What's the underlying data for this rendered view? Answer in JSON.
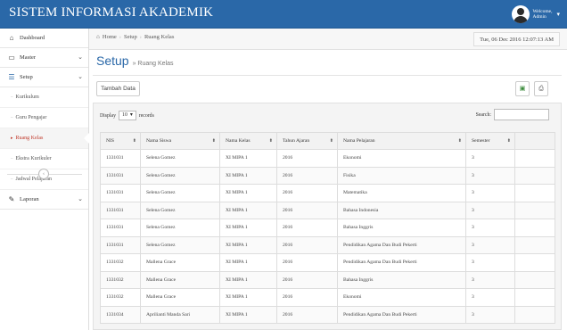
{
  "app": {
    "title": "SISTEM INFORMASI AKADEMIK"
  },
  "user": {
    "greeting": "Welcome,",
    "name": "Admin"
  },
  "sidebar": {
    "items": [
      {
        "label": "Dashboard",
        "icon": "dashboard-icon"
      },
      {
        "label": "Master",
        "icon": "monitor-icon"
      },
      {
        "label": "Setup",
        "icon": "list-icon"
      },
      {
        "label": "Laporan",
        "icon": "edit-icon"
      }
    ],
    "setup_children": [
      "Kurikulum",
      "Guru Pengajar",
      "Ruang Kelas",
      "Ekstra Kurikuler",
      "Jadwal Pelajaran"
    ],
    "active": "Ruang Kelas"
  },
  "breadcrumb": {
    "home": "Home",
    "setup": "Setup",
    "current": "Ruang Kelas"
  },
  "datetime": "Tue, 06 Dec 2016  12:07:13 AM",
  "page": {
    "title": "Setup",
    "subtitle": "» Ruang Kelas"
  },
  "toolbar": {
    "add_label": "Tambah Data"
  },
  "table_controls": {
    "display_label": "Display",
    "display_value": "10",
    "records_label": "records",
    "search_label": "Search:"
  },
  "table": {
    "headers": [
      "NIS",
      "Nama Siswa",
      "Nama Kelas",
      "Tahun Ajaran",
      "Nama Pelajaran",
      "Semester"
    ],
    "rows": [
      [
        "1331031",
        "Selena Gomez",
        "XI MIPA 1",
        "2016",
        "Ekonomi",
        "3"
      ],
      [
        "1331031",
        "Selena Gomez",
        "XI MIPA 1",
        "2016",
        "Fisika",
        "3"
      ],
      [
        "1331031",
        "Selena Gomez",
        "XI MIPA 1",
        "2016",
        "Matematika",
        "3"
      ],
      [
        "1331031",
        "Selena Gomez",
        "XI MIPA 1",
        "2016",
        "Bahasa Indonesia",
        "3"
      ],
      [
        "1331031",
        "Selena Gomez",
        "XI MIPA 1",
        "2016",
        "Bahasa Inggris",
        "3"
      ],
      [
        "1331031",
        "Selena Gomez",
        "XI MIPA 1",
        "2016",
        "Pendidikan Agama Dan Budi Pekerti",
        "3"
      ],
      [
        "1331032",
        "Mallena Grace",
        "XI MIPA 1",
        "2016",
        "Pendidikan Agama Dan Budi Pekerti",
        "3"
      ],
      [
        "1331032",
        "Mallena Grace",
        "XI MIPA 1",
        "2016",
        "Bahasa Inggris",
        "3"
      ],
      [
        "1331032",
        "Mallena Grace",
        "XI MIPA 1",
        "2016",
        "Ekonomi",
        "3"
      ],
      [
        "1331034",
        "Aprilianti Manda Sari",
        "XI MIPA 1",
        "2016",
        "Pendidikan Agama Dan Budi Pekerti",
        "3"
      ]
    ]
  },
  "colors": {
    "header_bg": "#2a68a8",
    "accent": "#2a68a8",
    "active_item": "#c0392b"
  }
}
